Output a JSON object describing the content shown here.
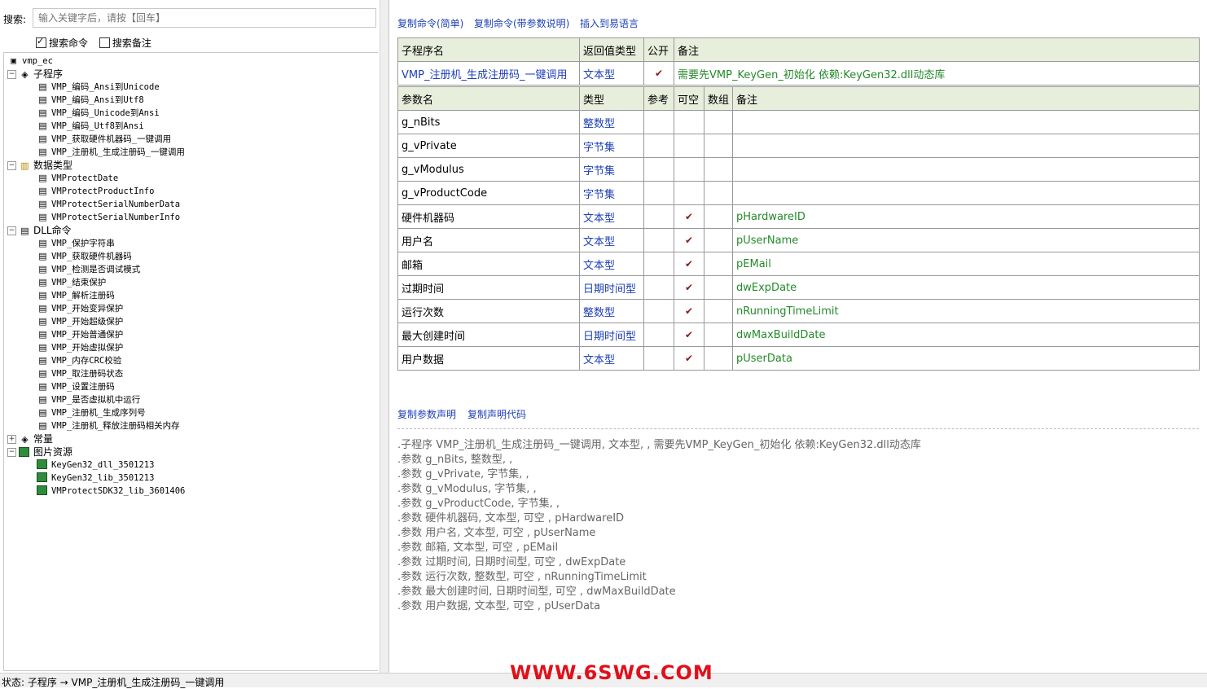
{
  "search": {
    "label": "搜索:",
    "placeholder": "输入关键字后，请按【回车】"
  },
  "filters": [
    {
      "label": "搜索命令",
      "checked": true
    },
    {
      "label": "搜索备注",
      "checked": false
    }
  ],
  "tree": {
    "root": "vmp_ec",
    "subprograms": {
      "label": "子程序",
      "items": [
        "VMP_编码_Ansi到Unicode",
        "VMP_编码_Ansi到Utf8",
        "VMP_编码_Unicode到Ansi",
        "VMP_编码_Utf8到Ansi",
        "VMP_获取硬件机器码_一键调用",
        "VMP_注册机_生成注册码_一键调用"
      ]
    },
    "datatypes": {
      "label": "数据类型",
      "items": [
        "VMProtectDate",
        "VMProtectProductInfo",
        "VMProtectSerialNumberData",
        "VMProtectSerialNumberInfo"
      ]
    },
    "dll": {
      "label": "DLL命令",
      "items": [
        "VMP_保护字符串",
        "VMP_获取硬件机器码",
        "VMP_检测是否调试模式",
        "VMP_结束保护",
        "VMP_解析注册码",
        "VMP_开始变异保护",
        "VMP_开始超级保护",
        "VMP_开始普通保护",
        "VMP_开始虚拟保护",
        "VMP_内存CRC校验",
        "VMP_取注册码状态",
        "VMP_设置注册码",
        "VMP_是否虚拟机中运行",
        "VMP_注册机_生成序列号",
        "VMP_注册机_释放注册码相关内存"
      ]
    },
    "constants": {
      "label": "常量"
    },
    "images": {
      "label": "图片资源",
      "items": [
        "KeyGen32_dll_3501213",
        "KeyGen32_lib_3501213",
        "VMProtectSDK32_lib_3601406"
      ]
    }
  },
  "top_links": [
    "复制命令(简单)",
    "复制命令(带参数说明)",
    "插入到易语言"
  ],
  "sub_header": {
    "name": "子程序名",
    "ret": "返回值类型",
    "public": "公开",
    "note": "备注"
  },
  "sub_row": {
    "name": "VMP_注册机_生成注册码_一键调用",
    "ret": "文本型",
    "public": "✔",
    "note": "需要先VMP_KeyGen_初始化 依赖:KeyGen32.dll动态库"
  },
  "param_header": {
    "name": "参数名",
    "type": "类型",
    "ref": "参考",
    "nullable": "可空",
    "array": "数组",
    "note": "备注"
  },
  "params": [
    {
      "name": "g_nBits",
      "type": "整数型",
      "nullable": "",
      "note": ""
    },
    {
      "name": "g_vPrivate",
      "type": "字节集",
      "nullable": "",
      "note": ""
    },
    {
      "name": "g_vModulus",
      "type": "字节集",
      "nullable": "",
      "note": ""
    },
    {
      "name": "g_vProductCode",
      "type": "字节集",
      "nullable": "",
      "note": ""
    },
    {
      "name": "硬件机器码",
      "type": "文本型",
      "nullable": "✔",
      "note": "pHardwareID"
    },
    {
      "name": "用户名",
      "type": "文本型",
      "nullable": "✔",
      "note": "pUserName"
    },
    {
      "name": "邮箱",
      "type": "文本型",
      "nullable": "✔",
      "note": "pEMail"
    },
    {
      "name": "过期时间",
      "type": "日期时间型",
      "nullable": "✔",
      "note": "dwExpDate"
    },
    {
      "name": "运行次数",
      "type": "整数型",
      "nullable": "✔",
      "note": "nRunningTimeLimit"
    },
    {
      "name": "最大创建时间",
      "type": "日期时间型",
      "nullable": "✔",
      "note": "dwMaxBuildDate"
    },
    {
      "name": "用户数据",
      "type": "文本型",
      "nullable": "✔",
      "note": "pUserData"
    }
  ],
  "bottom_links": [
    "复制参数声明",
    "复制声明代码"
  ],
  "declaration": [
    ".子程序 VMP_注册机_生成注册码_一键调用, 文本型, , 需要先VMP_KeyGen_初始化 依赖:KeyGen32.dll动态库",
    ".参数 g_nBits, 整数型, ,",
    ".参数 g_vPrivate, 字节集, ,",
    ".参数 g_vModulus, 字节集, ,",
    ".参数 g_vProductCode, 字节集, ,",
    ".参数 硬件机器码, 文本型, 可空 , pHardwareID",
    ".参数 用户名, 文本型, 可空 , pUserName",
    ".参数 邮箱, 文本型, 可空 , pEMail",
    ".参数 过期时间, 日期时间型, 可空 , dwExpDate",
    ".参数 运行次数, 整数型, 可空 , nRunningTimeLimit",
    ".参数 最大创建时间, 日期时间型, 可空 , dwMaxBuildDate",
    ".参数 用户数据, 文本型, 可空 , pUserData"
  ],
  "status": "状态:  子程序 → VMP_注册机_生成注册码_一键调用",
  "watermark": "WWW.6SWG.COM",
  "colors": {
    "link": "#1d3fb6",
    "note": "#248a2a",
    "header_bg": "#e8eedc",
    "watermark": "#e0101a"
  }
}
